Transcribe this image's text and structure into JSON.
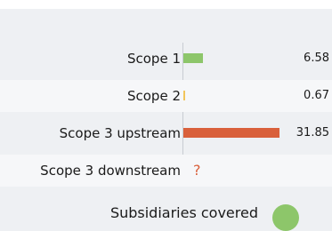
{
  "chart_data": {
    "type": "bar",
    "orientation": "horizontal",
    "categories": [
      "Scope 1",
      "Scope 2",
      "Scope 3 upstream",
      "Scope 3 downstream"
    ],
    "values": [
      6.58,
      0.67,
      31.85,
      null
    ],
    "value_labels": [
      "6.58",
      "0.67",
      "31.85",
      "?"
    ],
    "colors": [
      "#8dc66a",
      "#f1c55b",
      "#d9603b",
      "#d9603b"
    ],
    "xlim": [
      0,
      32
    ]
  },
  "footer": {
    "label": "Subsidiaries covered",
    "indicator_color": "#8dc66a"
  }
}
